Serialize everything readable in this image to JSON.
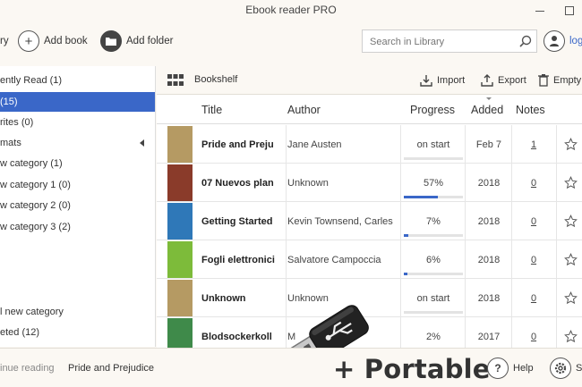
{
  "window": {
    "title": "Ebook reader PRO"
  },
  "toolbar": {
    "library_partial": "ry",
    "add_book": "Add book",
    "add_folder": "Add folder",
    "search_placeholder": "Search in Library",
    "login_partial": "log"
  },
  "sidebar": {
    "items": [
      {
        "label": "ently Read (1)"
      },
      {
        "label": "(15)",
        "selected": true
      },
      {
        "label": "rites (0)"
      },
      {
        "label": "mats"
      },
      {
        "label": "w category (1)"
      },
      {
        "label": "w category 1 (0)"
      },
      {
        "label": "w category 2 (0)"
      },
      {
        "label": "w category 3 (2)"
      },
      {
        "label": "l new category"
      },
      {
        "label": "eted (12)"
      }
    ]
  },
  "main": {
    "view_label": "Bookshelf",
    "import": "Import",
    "export": "Export",
    "empty": "Empty"
  },
  "table": {
    "columns": {
      "title": "Title",
      "author": "Author",
      "progress": "Progress",
      "added": "Added",
      "notes": "Notes"
    },
    "rows": [
      {
        "title": "Pride and Preju",
        "author": "Jane Austen",
        "progress": "on start",
        "progress_fraction": 0,
        "added": "Feb 7",
        "notes": "1",
        "cover_color": "#b59a63"
      },
      {
        "title": "07 Nuevos plan",
        "author": "Unknown",
        "progress": "57%",
        "progress_fraction": 0.57,
        "added": "2018",
        "notes": "0",
        "cover_color": "#8a3b2a"
      },
      {
        "title": "Getting Started",
        "author": "Kevin Townsend, Carles",
        "progress": "7%",
        "progress_fraction": 0.07,
        "added": "2018",
        "notes": "0",
        "cover_color": "#2f78b8"
      },
      {
        "title": "Fogli elettronici",
        "author": "Salvatore Campoccia",
        "progress": "6%",
        "progress_fraction": 0.06,
        "added": "2018",
        "notes": "0",
        "cover_color": "#7dbb3a"
      },
      {
        "title": "Unknown",
        "author": "Unknown",
        "progress": "on start",
        "progress_fraction": 0,
        "added": "2018",
        "notes": "0",
        "cover_color": "#b59a63"
      },
      {
        "title": "Blodsockerkoll",
        "author": "M",
        "progress": "2%",
        "progress_fraction": 0.02,
        "added": "2017",
        "notes": "0",
        "cover_color": "#3f8a4a"
      }
    ]
  },
  "status": {
    "continue_label": "inue reading",
    "continue_book": "Pride and Prejudice",
    "portable": "+ Portable",
    "help": "Help",
    "settings_partial": "S"
  },
  "colors": {
    "accent": "#3a67c8",
    "background": "#fbf8f3"
  }
}
